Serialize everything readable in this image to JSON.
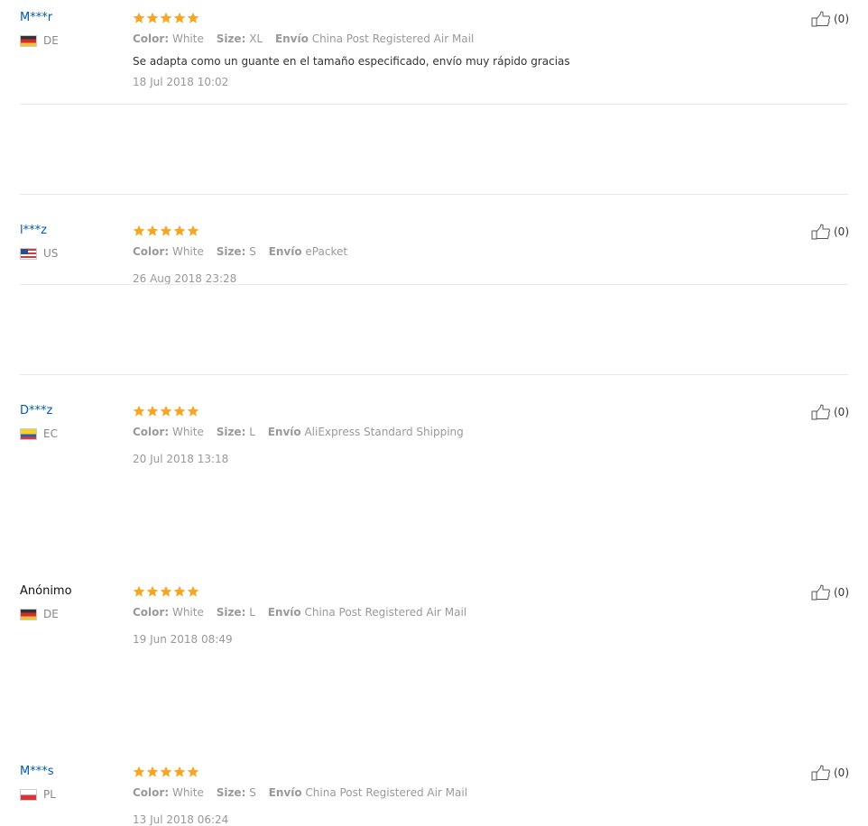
{
  "reviews": [
    {
      "user": "M***r",
      "anonymous": false,
      "country": "DE",
      "stars": 5,
      "color_label": "Color:",
      "color": "White",
      "size_label": "Size:",
      "size": "XL",
      "shipping_label": "Envío",
      "shipping": "China Post Registered Air Mail",
      "text": "Se adapta como un guante en el tamaño especificado, envío muy rápido gracias",
      "date": "18 Jul 2018 10:02",
      "helpful": "(0)"
    },
    {
      "user": "l***z",
      "anonymous": false,
      "country": "US",
      "stars": 5,
      "color_label": "Color:",
      "color": "White",
      "size_label": "Size:",
      "size": "S",
      "shipping_label": "Envío",
      "shipping": "ePacket",
      "text": "",
      "date": "26 Aug 2018 23:28",
      "helpful": "(0)"
    },
    {
      "user": "D***z",
      "anonymous": false,
      "country": "EC",
      "stars": 5,
      "color_label": "Color:",
      "color": "White",
      "size_label": "Size:",
      "size": "L",
      "shipping_label": "Envío",
      "shipping": "AliExpress Standard Shipping",
      "text": "",
      "date": "20 Jul 2018 13:18",
      "helpful": "(0)"
    },
    {
      "user": "Anónimo",
      "anonymous": true,
      "country": "DE",
      "stars": 5,
      "color_label": "Color:",
      "color": "White",
      "size_label": "Size:",
      "size": "L",
      "shipping_label": "Envío",
      "shipping": "China Post Registered Air Mail",
      "text": "",
      "date": "19 Jun 2018 08:49",
      "helpful": "(0)"
    },
    {
      "user": "M***s",
      "anonymous": false,
      "country": "PL",
      "stars": 5,
      "color_label": "Color:",
      "color": "White",
      "size_label": "Size:",
      "size": "S",
      "shipping_label": "Envío",
      "shipping": "China Post Registered Air Mail",
      "text": "",
      "date": "13 Jul 2018 06:24",
      "helpful": "(0)"
    }
  ],
  "colors": {
    "username": "#0059b3",
    "star": "#f5a623",
    "meta": "#999999",
    "divider": "#e8e8e8"
  }
}
